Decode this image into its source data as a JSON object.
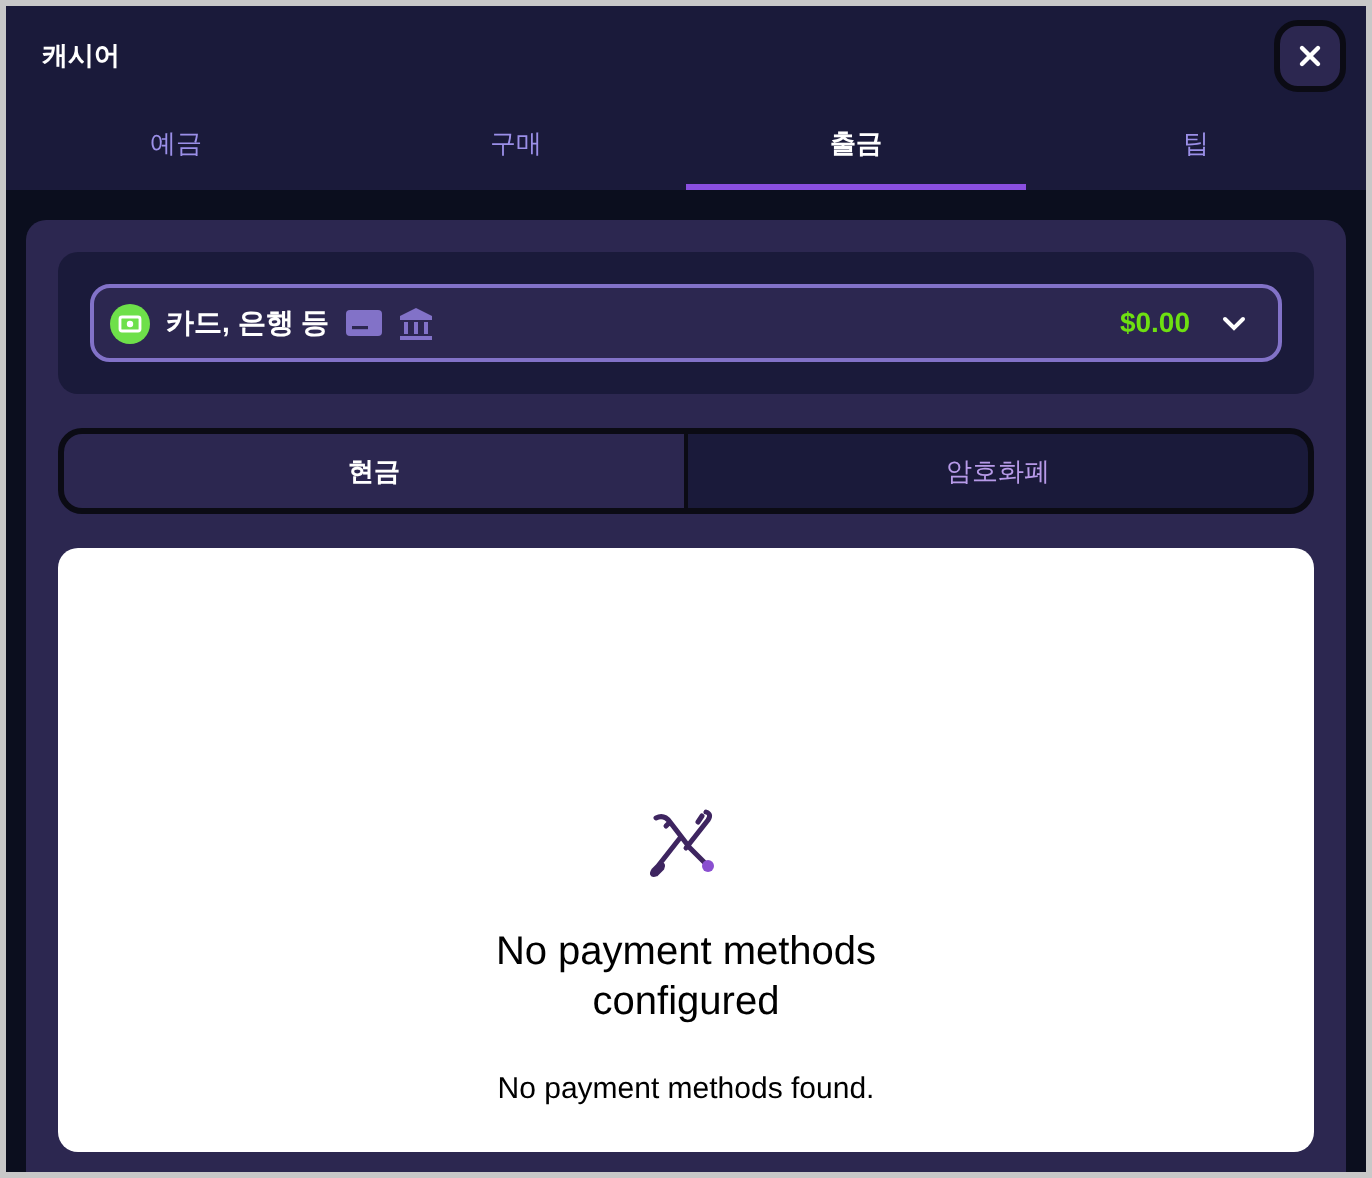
{
  "window": {
    "title": "캐시어"
  },
  "tabs": [
    {
      "label": "예금",
      "selected": false
    },
    {
      "label": "구매",
      "selected": false
    },
    {
      "label": "출금",
      "selected": true
    },
    {
      "label": "팁",
      "selected": false
    }
  ],
  "method_select": {
    "label": "카드, 은행 등",
    "balance": "$0.00"
  },
  "currency_tabs": [
    {
      "label": "현금",
      "selected": true
    },
    {
      "label": "암호화폐",
      "selected": false
    }
  ],
  "empty_state": {
    "title": "No payment methods configured",
    "message": "No payment methods found."
  }
}
